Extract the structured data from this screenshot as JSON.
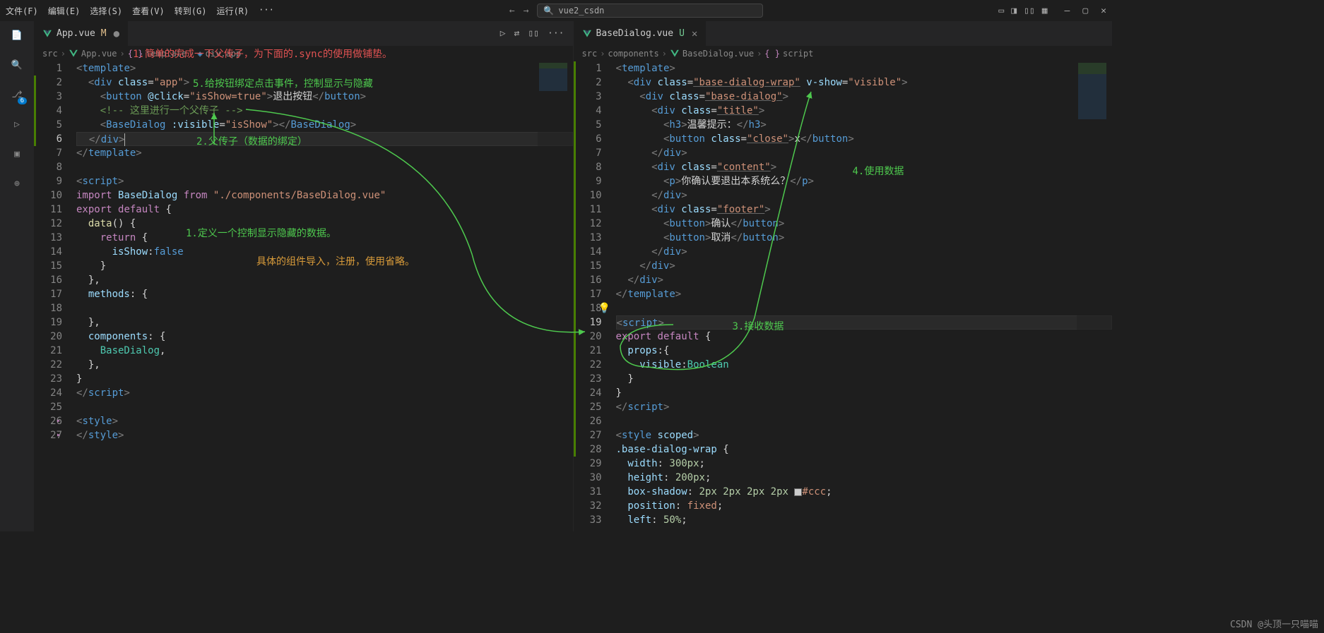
{
  "titlebar": {
    "menu": [
      "文件(F)",
      "编辑(E)",
      "选择(S)",
      "查看(V)",
      "转到(G)",
      "运行(R)",
      "···"
    ],
    "search_placeholder": "vue2_csdn"
  },
  "activity_badge": "6",
  "panes": {
    "left": {
      "tab": {
        "filename": "App.vue",
        "badge": "M"
      },
      "breadcrumb": [
        "src",
        "App.vue",
        "template",
        "div.app"
      ],
      "lines": [
        {
          "n": 1,
          "html": "<span class='tag-bracket'>&lt;</span><span class='tag-name'>template</span><span class='tag-bracket'>&gt;</span>"
        },
        {
          "n": 2,
          "html": "  <span class='tag-bracket'>&lt;</span><span class='tag-name'>div</span> <span class='attr-name'>class</span>=<span class='attr-val'>\"app\"</span><span class='tag-bracket'>&gt;</span>"
        },
        {
          "n": 3,
          "html": "    <span class='tag-bracket'>&lt;</span><span class='tag-name'>button</span> <span class='attr-name'>@click</span>=<span class='attr-val'>\"isShow=true\"</span><span class='tag-bracket'>&gt;</span><span class='text'>退出按钮</span><span class='tag-bracket'>&lt;/</span><span class='tag-name'>button</span><span class='tag-bracket'>&gt;</span>"
        },
        {
          "n": 4,
          "html": "    <span class='comment'>&lt;!-- 这里进行一个父传子 --&gt;</span>"
        },
        {
          "n": 5,
          "html": "    <span class='tag-bracket'>&lt;</span><span class='tag-name'>BaseDialog</span> <span class='attr-name'>:visible</span>=<span class='attr-val'>\"isShow\"</span><span class='tag-bracket'>&gt;&lt;/</span><span class='tag-name'>BaseDialog</span><span class='tag-bracket'>&gt;</span>"
        },
        {
          "n": 6,
          "active": true,
          "html": "  <span class='tag-bracket'>&lt;/</span><span class='tag-name'>div</span><span class='tag-bracket'>&gt;</span><span style='border-left:1px solid #aeafad;height:18px;display:inline-block;vertical-align:middle'></span>"
        },
        {
          "n": 7,
          "html": "<span class='tag-bracket'>&lt;/</span><span class='tag-name'>template</span><span class='tag-bracket'>&gt;</span>"
        },
        {
          "n": 8,
          "html": ""
        },
        {
          "n": 9,
          "html": "<span class='tag-bracket'>&lt;</span><span class='tag-name'>script</span><span class='tag-bracket'>&gt;</span>"
        },
        {
          "n": 10,
          "html": "<span class='keyword'>import</span> <span class='var'>BaseDialog</span> <span class='keyword'>from</span> <span class='string'>\"./components/BaseDialog.vue\"</span>"
        },
        {
          "n": 11,
          "html": "<span class='keyword'>export</span> <span class='keyword'>default</span> <span class='punct'>{</span>"
        },
        {
          "n": 12,
          "html": "  <span class='func'>data</span><span class='punct'>() {</span>"
        },
        {
          "n": 13,
          "html": "    <span class='keyword'>return</span> <span class='punct'>{</span>"
        },
        {
          "n": 14,
          "html": "      <span class='var'>isShow</span><span class='punct'>:</span><span class='keyword-blue'>false</span>"
        },
        {
          "n": 15,
          "html": "    <span class='punct'>}</span>"
        },
        {
          "n": 16,
          "html": "  <span class='punct'>},</span>"
        },
        {
          "n": 17,
          "html": "  <span class='var'>methods</span><span class='punct'>: {</span>"
        },
        {
          "n": 18,
          "html": ""
        },
        {
          "n": 19,
          "html": "  <span class='punct'>},</span>"
        },
        {
          "n": 20,
          "html": "  <span class='var'>components</span><span class='punct'>: {</span>"
        },
        {
          "n": 21,
          "html": "    <span class='class-name'>BaseDialog</span><span class='punct'>,</span>"
        },
        {
          "n": 22,
          "html": "  <span class='punct'>},</span>"
        },
        {
          "n": 23,
          "html": "<span class='punct'>}</span>"
        },
        {
          "n": 24,
          "html": "<span class='tag-bracket'>&lt;/</span><span class='tag-name'>script</span><span class='tag-bracket'>&gt;</span>"
        },
        {
          "n": 25,
          "html": ""
        },
        {
          "n": 26,
          "fold": true,
          "html": "<span class='tag-bracket'>&lt;</span><span class='tag-name'>style</span><span class='tag-bracket'>&gt;</span>"
        },
        {
          "n": 27,
          "fold": true,
          "html": "<span class='tag-bracket'>&lt;/</span><span class='tag-name'>style</span><span class='tag-bracket'>&gt;</span>"
        }
      ]
    },
    "right": {
      "tab": {
        "filename": "BaseDialog.vue",
        "badge": "U"
      },
      "breadcrumb": [
        "src",
        "components",
        "BaseDialog.vue",
        "script"
      ],
      "lines": [
        {
          "n": 1,
          "html": "<span class='tag-bracket'>&lt;</span><span class='tag-name'>template</span><span class='tag-bracket'>&gt;</span>"
        },
        {
          "n": 2,
          "html": "  <span class='tag-bracket'>&lt;</span><span class='tag-name'>div</span> <span class='attr-name'>class</span>=<span class='attr-val underline'>\"base-dialog-wrap\"</span> <span class='attr-name'>v-show</span>=<span class='attr-val'>\"visible\"</span><span class='tag-bracket'>&gt;</span>"
        },
        {
          "n": 3,
          "html": "    <span class='tag-bracket'>&lt;</span><span class='tag-name'>div</span> <span class='attr-name'>class</span>=<span class='attr-val underline'>\"base-dialog\"</span><span class='tag-bracket'>&gt;</span>"
        },
        {
          "n": 4,
          "html": "      <span class='tag-bracket'>&lt;</span><span class='tag-name'>div</span> <span class='attr-name'>class</span>=<span class='attr-val underline'>\"title\"</span><span class='tag-bracket'>&gt;</span>"
        },
        {
          "n": 5,
          "html": "        <span class='tag-bracket'>&lt;</span><span class='tag-name'>h3</span><span class='tag-bracket'>&gt;</span><span class='text'>温馨提示：</span><span class='tag-bracket'>&lt;/</span><span class='tag-name'>h3</span><span class='tag-bracket'>&gt;</span>"
        },
        {
          "n": 6,
          "html": "        <span class='tag-bracket'>&lt;</span><span class='tag-name'>button</span> <span class='attr-name'>class</span>=<span class='attr-val underline'>\"close\"</span><span class='tag-bracket'>&gt;</span><span class='text'>x</span><span class='tag-bracket'>&lt;/</span><span class='tag-name'>button</span><span class='tag-bracket'>&gt;</span>"
        },
        {
          "n": 7,
          "html": "      <span class='tag-bracket'>&lt;/</span><span class='tag-name'>div</span><span class='tag-bracket'>&gt;</span>"
        },
        {
          "n": 8,
          "html": "      <span class='tag-bracket'>&lt;</span><span class='tag-name'>div</span> <span class='attr-name'>class</span>=<span class='attr-val underline'>\"content\"</span><span class='tag-bracket'>&gt;</span>"
        },
        {
          "n": 9,
          "html": "        <span class='tag-bracket'>&lt;</span><span class='tag-name'>p</span><span class='tag-bracket'>&gt;</span><span class='text'>你确认要退出本系统么？</span><span class='tag-bracket'>&lt;/</span><span class='tag-name'>p</span><span class='tag-bracket'>&gt;</span>"
        },
        {
          "n": 10,
          "html": "      <span class='tag-bracket'>&lt;/</span><span class='tag-name'>div</span><span class='tag-bracket'>&gt;</span>"
        },
        {
          "n": 11,
          "html": "      <span class='tag-bracket'>&lt;</span><span class='tag-name'>div</span> <span class='attr-name'>class</span>=<span class='attr-val underline'>\"footer\"</span><span class='tag-bracket'>&gt;</span>"
        },
        {
          "n": 12,
          "html": "        <span class='tag-bracket'>&lt;</span><span class='tag-name'>button</span><span class='tag-bracket'>&gt;</span><span class='text'>确认</span><span class='tag-bracket'>&lt;/</span><span class='tag-name'>button</span><span class='tag-bracket'>&gt;</span>"
        },
        {
          "n": 13,
          "html": "        <span class='tag-bracket'>&lt;</span><span class='tag-name'>button</span><span class='tag-bracket'>&gt;</span><span class='text'>取消</span><span class='tag-bracket'>&lt;/</span><span class='tag-name'>button</span><span class='tag-bracket'>&gt;</span>"
        },
        {
          "n": 14,
          "html": "      <span class='tag-bracket'>&lt;/</span><span class='tag-name'>div</span><span class='tag-bracket'>&gt;</span>"
        },
        {
          "n": 15,
          "html": "    <span class='tag-bracket'>&lt;/</span><span class='tag-name'>div</span><span class='tag-bracket'>&gt;</span>"
        },
        {
          "n": 16,
          "html": "  <span class='tag-bracket'>&lt;/</span><span class='tag-name'>div</span><span class='tag-bracket'>&gt;</span>"
        },
        {
          "n": 17,
          "html": "<span class='tag-bracket'>&lt;/</span><span class='tag-name'>template</span><span class='tag-bracket'>&gt;</span>"
        },
        {
          "n": 18,
          "bulb": true,
          "html": ""
        },
        {
          "n": 19,
          "active": true,
          "html": "<span class='tag-bracket'>&lt;</span><span class='tag-name'>script</span><span class='tag-bracket'>&gt;</span>"
        },
        {
          "n": 20,
          "html": "<span class='keyword'>export</span> <span class='keyword'>default</span> <span class='punct'>{</span>"
        },
        {
          "n": 21,
          "html": "  <span class='var'>props</span><span class='punct'>:{</span>"
        },
        {
          "n": 22,
          "html": "    <span class='var'>visible</span><span class='punct'>:</span><span class='class-name'>Boolean</span>"
        },
        {
          "n": 23,
          "html": "  <span class='punct'>}</span>"
        },
        {
          "n": 24,
          "html": "<span class='punct'>}</span>"
        },
        {
          "n": 25,
          "html": "<span class='tag-bracket'>&lt;/</span><span class='tag-name'>script</span><span class='tag-bracket'>&gt;</span>"
        },
        {
          "n": 26,
          "html": ""
        },
        {
          "n": 27,
          "html": "<span class='tag-bracket'>&lt;</span><span class='tag-name'>style</span> <span class='attr-name'>scoped</span><span class='tag-bracket'>&gt;</span>"
        },
        {
          "n": 28,
          "html": "<span class='attr-name'>.base-dialog-wrap</span> <span class='punct'>{</span>"
        },
        {
          "n": 29,
          "html": "  <span class='css-prop'>width</span><span class='punct'>:</span> <span class='css-num'>300px</span><span class='punct'>;</span>"
        },
        {
          "n": 30,
          "html": "  <span class='css-prop'>height</span><span class='punct'>:</span> <span class='css-num'>200px</span><span class='punct'>;</span>"
        },
        {
          "n": 31,
          "html": "  <span class='css-prop'>box-shadow</span><span class='punct'>:</span> <span class='css-num'>2px 2px 2px 2px</span> <span style='background:#ccc;display:inline-block;width:11px;height:11px;border:1px solid #666;vertical-align:middle'></span><span class='css-val'>#ccc</span><span class='punct'>;</span>"
        },
        {
          "n": 32,
          "html": "  <span class='css-prop'>position</span><span class='punct'>:</span> <span class='css-val'>fixed</span><span class='punct'>;</span>"
        },
        {
          "n": 33,
          "html": "  <span class='css-prop'>left</span><span class='punct'>:</span> <span class='css-num'>50%</span><span class='punct'>;</span>"
        }
      ]
    }
  },
  "annotations": {
    "a1": "1.简单的完成一下父传子，为下面的.sync的使用做铺垫。",
    "a5": "5.给按钮绑定点击事件，控制显示与隐藏",
    "a2": "2.父传子（数据的绑定）",
    "a1def": "1.定义一个控制显示隐藏的数据。",
    "comp": "具体的组件导入，注册，使用省略。",
    "a4": "4.使用数据",
    "a3": "3.接收数据"
  },
  "watermark": "CSDN @头顶一只喵喵"
}
